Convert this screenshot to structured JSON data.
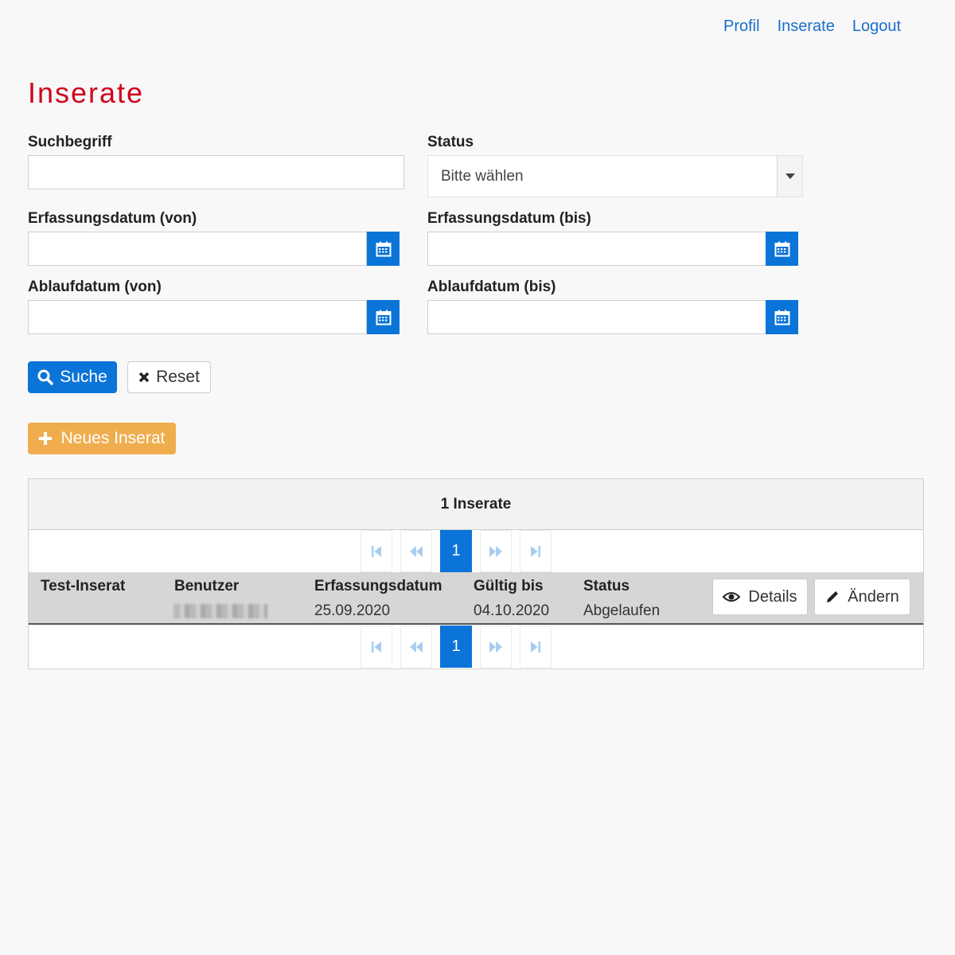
{
  "nav": {
    "items": [
      "Profil",
      "Inserate",
      "Logout"
    ]
  },
  "page_title": "Inserate",
  "form": {
    "suchbegriff_label": "Suchbegriff",
    "suchbegriff_value": "",
    "status_label": "Status",
    "status_value": "Bitte wählen",
    "erfassung_von_label": "Erfassungsdatum (von)",
    "erfassung_bis_label": "Erfassungsdatum (bis)",
    "ablauf_von_label": "Ablaufdatum (von)",
    "ablauf_bis_label": "Ablaufdatum (bis)"
  },
  "buttons": {
    "search": "Suche",
    "reset": "Reset",
    "new": "Neues Inserat"
  },
  "results": {
    "count_title": "1 Inserate",
    "current_page": "1",
    "columns": [
      "Test-Inserat",
      "Benutzer",
      "Erfassungsdatum",
      "Gültig bis",
      "Status"
    ],
    "rows": [
      {
        "erfassungsdatum": "25.09.2020",
        "gueltig_bis": "04.10.2020",
        "status": "Abgelaufen"
      }
    ],
    "details_label": "Details",
    "edit_label": "Ändern"
  },
  "colors": {
    "accent": "#0a74d8",
    "title": "#d0021b",
    "warning": "#f0ad4e"
  }
}
